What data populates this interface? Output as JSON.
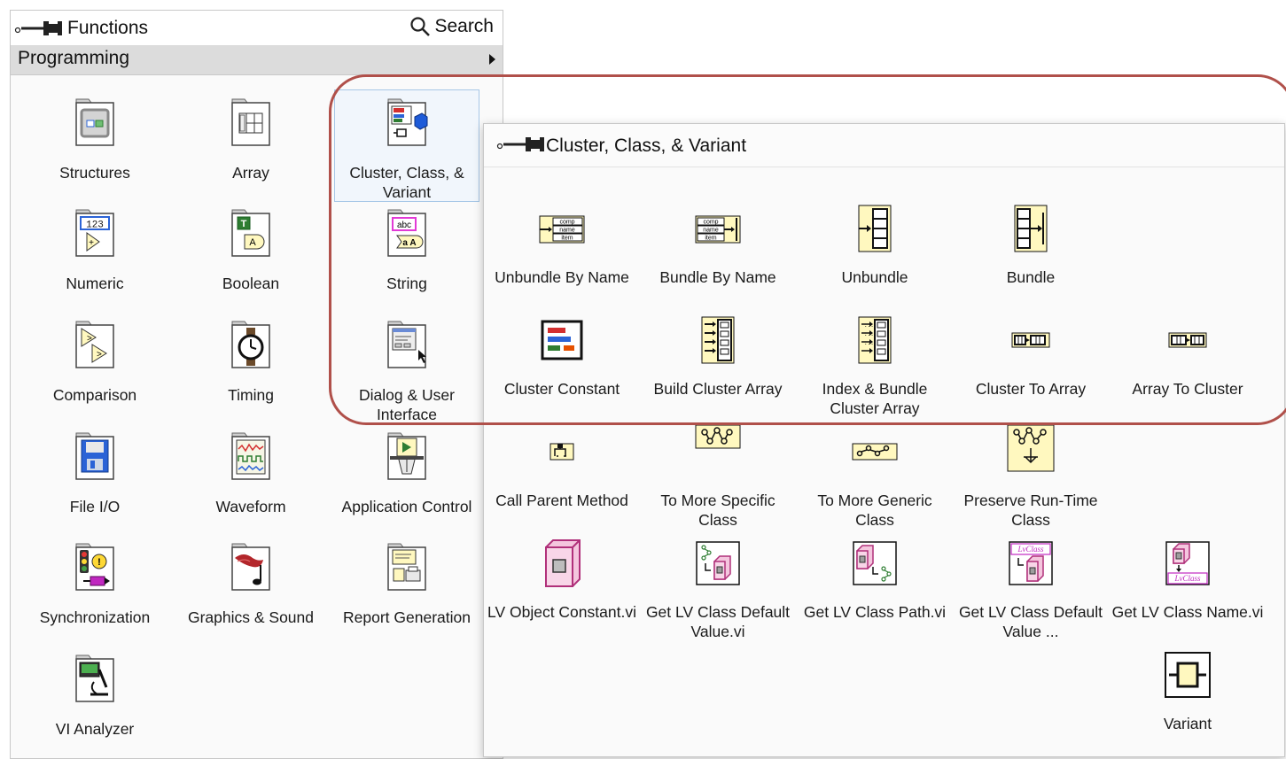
{
  "palette": {
    "title": "Functions",
    "search_label": "Search",
    "category": "Programming",
    "items": [
      {
        "label": "Structures",
        "icon": "structures-icon"
      },
      {
        "label": "Array",
        "icon": "array-icon"
      },
      {
        "label": "Cluster, Class, & Variant",
        "icon": "cluster-class-variant-icon",
        "selected": true
      },
      {
        "label": "Numeric",
        "icon": "numeric-icon"
      },
      {
        "label": "Boolean",
        "icon": "boolean-icon"
      },
      {
        "label": "String",
        "icon": "string-icon"
      },
      {
        "label": "Comparison",
        "icon": "comparison-icon"
      },
      {
        "label": "Timing",
        "icon": "timing-icon"
      },
      {
        "label": "Dialog & User Interface",
        "icon": "dialog-ui-icon"
      },
      {
        "label": "File I/O",
        "icon": "file-io-icon"
      },
      {
        "label": "Waveform",
        "icon": "waveform-icon"
      },
      {
        "label": "Application Control",
        "icon": "application-control-icon"
      },
      {
        "label": "Synchronization",
        "icon": "synchronization-icon"
      },
      {
        "label": "Graphics & Sound",
        "icon": "graphics-sound-icon"
      },
      {
        "label": "Report Generation",
        "icon": "report-generation-icon"
      },
      {
        "label": "VI Analyzer",
        "icon": "vi-analyzer-icon"
      }
    ]
  },
  "subpalette": {
    "title": "Cluster, Class, & Variant",
    "items": [
      {
        "label": "Unbundle By Name",
        "icon": "unbundle-by-name-icon"
      },
      {
        "label": "Bundle By Name",
        "icon": "bundle-by-name-icon"
      },
      {
        "label": "Unbundle",
        "icon": "unbundle-icon"
      },
      {
        "label": "Bundle",
        "icon": "bundle-icon"
      },
      {
        "label": "Cluster Constant",
        "icon": "cluster-constant-icon"
      },
      {
        "label": "Build Cluster Array",
        "icon": "build-cluster-array-icon"
      },
      {
        "label": "Index & Bundle Cluster Array",
        "icon": "index-bundle-cluster-array-icon"
      },
      {
        "label": "Cluster To Array",
        "icon": "cluster-to-array-icon"
      },
      {
        "label": "Array To Cluster",
        "icon": "array-to-cluster-icon"
      },
      {
        "label": "Call Parent Method",
        "icon": "call-parent-method-icon"
      },
      {
        "label": "To More Specific Class",
        "icon": "to-more-specific-class-icon"
      },
      {
        "label": "To More Generic Class",
        "icon": "to-more-generic-class-icon"
      },
      {
        "label": "Preserve Run-Time Class",
        "icon": "preserve-run-time-class-icon"
      },
      {
        "label": "LV Object Constant.vi",
        "icon": "lv-object-constant-icon"
      },
      {
        "label": "Get LV Class Default Value.vi",
        "icon": "get-lv-class-default-value-icon"
      },
      {
        "label": "Get LV Class Path.vi",
        "icon": "get-lv-class-path-icon"
      },
      {
        "label": "Get LV Class Default Value ...",
        "icon": "get-lv-class-default-value-by-name-icon"
      },
      {
        "label": "Get LV Class Name.vi",
        "icon": "get-lv-class-name-icon"
      },
      {
        "label": "Variant",
        "icon": "variant-icon"
      }
    ]
  },
  "glyphs": {
    "num": "123",
    "bool_t": "T",
    "bool_a": "A",
    "str_abc": "abc",
    "str_a": "a A",
    "lvclass": "LvClass",
    "cmp": "comp",
    "nme": "name",
    "itm": "item"
  },
  "colors": {
    "highlight_outline": "#b0504a",
    "selection_border": "#a7c7e7",
    "header_gray": "#dcdcdc",
    "icon_yellow": "#fff8bf",
    "class_pink": "#f4c6de",
    "accent_blue": "#2b63d6"
  }
}
